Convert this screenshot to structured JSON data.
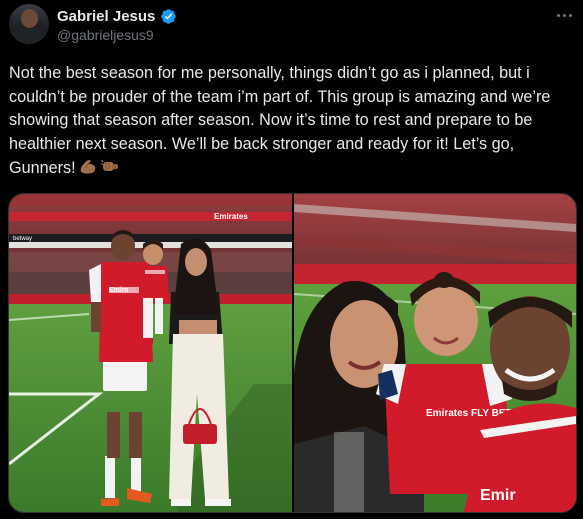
{
  "author": {
    "display_name": "Gabriel Jesus",
    "handle": "@gabrieljesus9",
    "verified": true,
    "verified_color": "#1d9bf0"
  },
  "post": {
    "text": "Not the best season for me personally, things didn’t go as i planned, but i couldn’t be prouder of the team i’m part of. This group is amazing and we’re showing that season after season. Now it’s time to rest and prepare to be healthier next season. We’ll be back stronger and ready for it! Let’s go, Gunners!",
    "emojis": [
      "flexed-biceps-medium-dark",
      "fist-bump-medium-dark"
    ]
  },
  "media": {
    "count": 2,
    "photos": [
      {
        "subject": "player-holding-child-with-woman-on-pitch",
        "board_text_left": "Emirates",
        "board_text_right": "",
        "ad_text": "betway",
        "jersey_text": "Emira"
      },
      {
        "subject": "selfie-woman-child-player",
        "jersey_text": "Emirates FLY BETTER",
        "jersey_text_bottom": "Emir"
      }
    ]
  },
  "colors": {
    "background": "#000000",
    "text": "#e7e9ea",
    "secondary": "#71767b",
    "border": "#2f3336",
    "arsenal_red": "#d11a2a"
  },
  "icons": [
    "verified-badge-icon",
    "more-options-icon"
  ]
}
